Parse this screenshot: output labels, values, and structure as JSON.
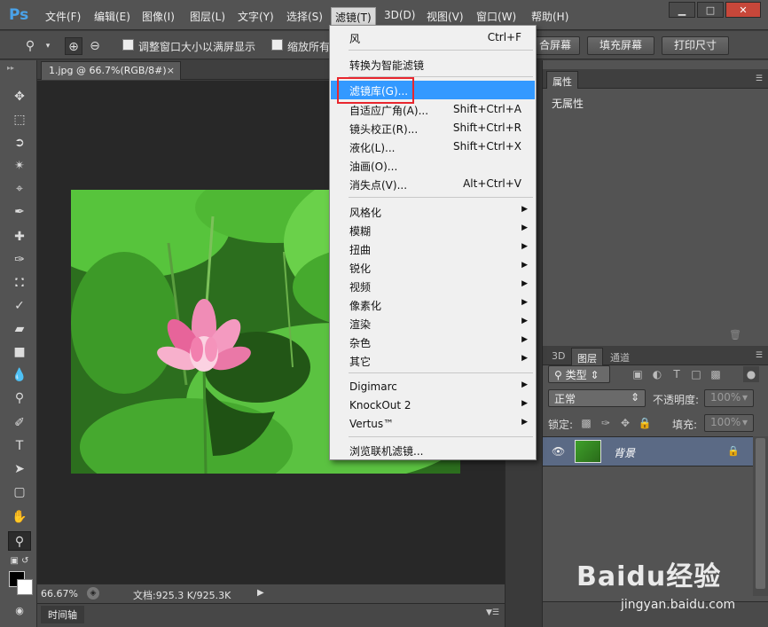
{
  "app": {
    "logo": "Ps"
  },
  "menubar": {
    "items": [
      "文件(F)",
      "编辑(E)",
      "图像(I)",
      "图层(L)",
      "文字(Y)",
      "选择(S)",
      "滤镜(T)",
      "3D(D)",
      "视图(V)",
      "窗口(W)",
      "帮助(H)"
    ],
    "active_index": 6
  },
  "window_buttons": {
    "minimize": "▁",
    "maximize": "□",
    "close": "✕"
  },
  "options_bar": {
    "checkbox1_label": "调整窗口大小以满屏显示",
    "checkbox2_label": "缩放所有",
    "btn_fit": "合屏幕",
    "btn_fill": "填充屏幕",
    "btn_print": "打印尺寸"
  },
  "document": {
    "tab_title": "1.jpg @ 66.7%(RGB/8#)",
    "tab_close": "×",
    "zoom": "66.67%",
    "doc_info": "文档:925.3 K/925.3K"
  },
  "timeline": {
    "tab": "时间轴"
  },
  "properties_panel": {
    "tab": "属性",
    "content": "无属性"
  },
  "layers_panel": {
    "tabs": [
      "3D",
      "图层",
      "通道"
    ],
    "active_tab": 1,
    "filter_kind": "类型",
    "blend_mode": "正常",
    "opacity_label": "不透明度:",
    "opacity_value": "100%",
    "lock_label": "锁定:",
    "fill_label": "填充:",
    "fill_value": "100%",
    "layer_name": "背景"
  },
  "filter_menu": {
    "items": [
      {
        "label": "风",
        "shortcut": "Ctrl+F"
      },
      {
        "label": "转换为智能滤镜",
        "shortcut": ""
      },
      {
        "label": "滤镜库(G)...",
        "shortcut": "",
        "hover": true
      },
      {
        "label": "自适应广角(A)...",
        "shortcut": "Shift+Ctrl+A"
      },
      {
        "label": "镜头校正(R)...",
        "shortcut": "Shift+Ctrl+R"
      },
      {
        "label": "液化(L)...",
        "shortcut": "Shift+Ctrl+X"
      },
      {
        "label": "油画(O)...",
        "shortcut": ""
      },
      {
        "label": "消失点(V)...",
        "shortcut": "Alt+Ctrl+V"
      },
      {
        "label": "风格化",
        "submenu": true
      },
      {
        "label": "模糊",
        "submenu": true
      },
      {
        "label": "扭曲",
        "submenu": true
      },
      {
        "label": "锐化",
        "submenu": true
      },
      {
        "label": "视频",
        "submenu": true
      },
      {
        "label": "像素化",
        "submenu": true
      },
      {
        "label": "渲染",
        "submenu": true
      },
      {
        "label": "杂色",
        "submenu": true
      },
      {
        "label": "其它",
        "submenu": true
      },
      {
        "label": "Digimarc",
        "submenu": true
      },
      {
        "label": "KnockOut 2",
        "submenu": true
      },
      {
        "label": "Vertus™",
        "submenu": true
      },
      {
        "label": "浏览联机滤镜...",
        "shortcut": ""
      }
    ]
  },
  "watermark": {
    "brand": "Baidu经验",
    "url": "jingyan.baidu.com"
  },
  "colors": {
    "menu_hover": "#3399ff",
    "highlight_box": "#e8262e",
    "ps_blue": "#4aa3ea",
    "layer_selected": "#5b6a85"
  },
  "icons": [
    "zoom-icon",
    "zoom-in-icon",
    "zoom-out-icon",
    "move-tool-icon",
    "marquee-tool-icon",
    "lasso-tool-icon",
    "magic-wand-icon",
    "crop-tool-icon",
    "eyedropper-icon",
    "healing-brush-icon",
    "brush-tool-icon",
    "clone-stamp-icon",
    "history-brush-icon",
    "eraser-icon",
    "gradient-tool-icon",
    "blur-tool-icon",
    "dodge-tool-icon",
    "pen-tool-icon",
    "type-tool-icon",
    "path-selection-icon",
    "rectangle-tool-icon",
    "hand-tool-icon",
    "zoom-tool-icon",
    "eye-icon",
    "lock-icon",
    "trash-icon"
  ]
}
